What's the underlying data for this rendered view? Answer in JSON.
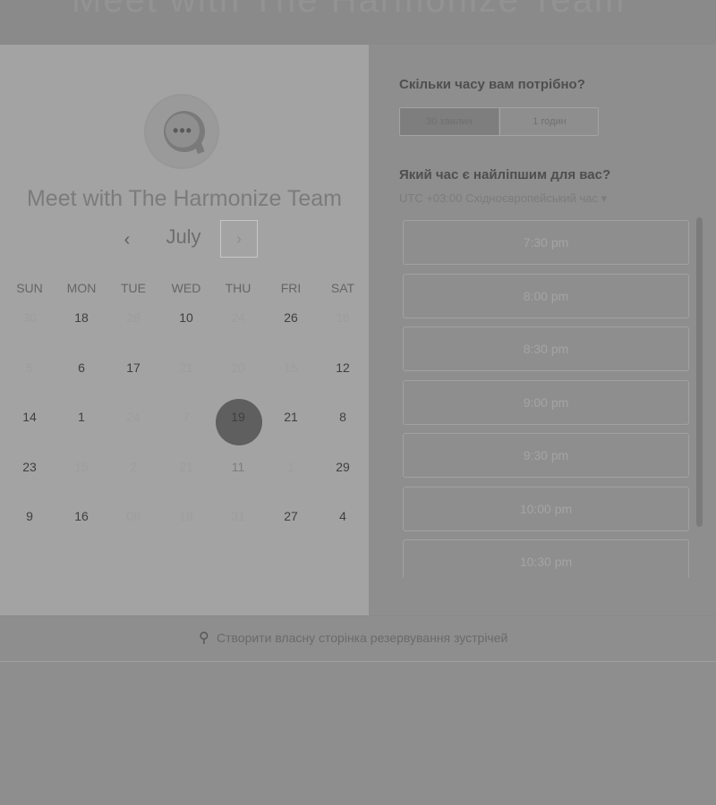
{
  "header": {
    "banner_text": "Meet with The Harmonize Team"
  },
  "calendar": {
    "title": "Meet with The Harmonize Team",
    "month": "July",
    "prev_icon": "chevron-left-icon",
    "next_icon": "chevron-right-icon",
    "weekdays": [
      "SUN",
      "MON",
      "TUE",
      "WED",
      "THU",
      "FRI",
      "SAT"
    ],
    "weeks": [
      [
        {
          "d": "30",
          "s": "faded"
        },
        {
          "d": "18",
          "s": "active"
        },
        {
          "d": "28",
          "s": "faded"
        },
        {
          "d": "10",
          "s": "active"
        },
        {
          "d": "24",
          "s": "faded"
        },
        {
          "d": "26",
          "s": "active"
        },
        {
          "d": "16",
          "s": "faded"
        }
      ],
      [
        {
          "d": "5",
          "s": "faded"
        },
        {
          "d": "6",
          "s": "active"
        },
        {
          "d": "17",
          "s": "active"
        },
        {
          "d": "21",
          "s": "faded"
        },
        {
          "d": "20",
          "s": "faded"
        },
        {
          "d": "15",
          "s": "faded"
        },
        {
          "d": "12",
          "s": "active"
        }
      ],
      [
        {
          "d": "14",
          "s": "active"
        },
        {
          "d": "1",
          "s": "active"
        },
        {
          "d": "24",
          "s": "faded"
        },
        {
          "d": "7",
          "s": "faded"
        },
        {
          "d": "19",
          "s": "active"
        },
        {
          "d": "21",
          "s": "active"
        },
        {
          "d": "8",
          "s": "active"
        }
      ],
      [
        {
          "d": "23",
          "s": "active"
        },
        {
          "d": "15",
          "s": "faded"
        },
        {
          "d": "2",
          "s": "faded"
        },
        {
          "d": "21",
          "s": "faded"
        },
        {
          "d": "11",
          "s": "selected"
        },
        {
          "d": "1",
          "s": "faded"
        },
        {
          "d": "29",
          "s": "active"
        }
      ],
      [
        {
          "d": "9",
          "s": "active"
        },
        {
          "d": "16",
          "s": "active"
        },
        {
          "d": "08",
          "s": "faded"
        },
        {
          "d": "19",
          "s": "faded"
        },
        {
          "d": "31",
          "s": "faded"
        },
        {
          "d": "27",
          "s": "active"
        },
        {
          "d": "4",
          "s": "active"
        }
      ]
    ]
  },
  "duration": {
    "question": "Скільки часу вам потрібно?",
    "options": [
      "30 хвилин",
      "1 годин"
    ],
    "selected": "30 хвилин"
  },
  "time": {
    "question": "Який час є найліпшим для вас?",
    "timezone": "UTC +03:00 Східноєвропейський час ▾",
    "slots": [
      "7:30 pm",
      "8:00 pm",
      "8:30 pm",
      "9:00 pm",
      "9:30 pm",
      "10:00 pm",
      "10:30 pm"
    ]
  },
  "footer": {
    "icon": "hubspot-sprocket-icon",
    "text": "Створити власну сторінка резервування зустрічей"
  }
}
